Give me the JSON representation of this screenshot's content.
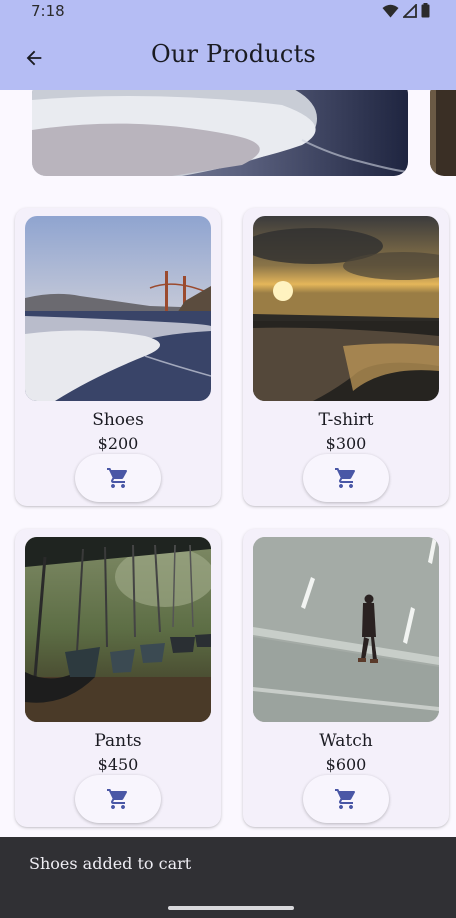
{
  "status_bar": {
    "time": "7:18"
  },
  "app_bar": {
    "title": "Our Products"
  },
  "products": [
    {
      "name": "Shoes",
      "price": "$200",
      "image": "beach-bridge"
    },
    {
      "name": "T-shirt",
      "price": "$300",
      "image": "sunset-beach"
    },
    {
      "name": "Pants",
      "price": "$450",
      "image": "swings"
    },
    {
      "name": "Watch",
      "price": "$600",
      "image": "man-on-road"
    }
  ],
  "snackbar": {
    "message": "Shoes added to cart"
  },
  "colors": {
    "app_bar": "#B5BDF4",
    "background": "#FBF8FF",
    "card": "#F4F0FA",
    "cart_icon": "#4A57A6",
    "snackbar": "#303034"
  }
}
